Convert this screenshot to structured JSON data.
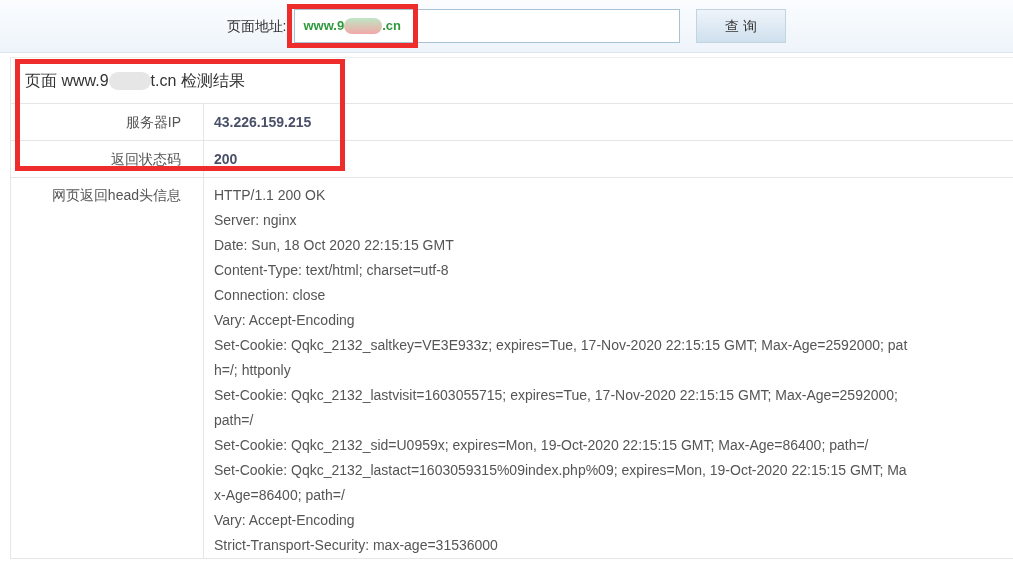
{
  "address_bar": {
    "highlighted": true,
    "label": "页面地址:",
    "value_prefix": "www.9",
    "value_redacted": true,
    "value_suffix": ".cn",
    "button": "查 询"
  },
  "result": {
    "highlighted": true,
    "title_prefix": "页面 www.9",
    "title_redacted": true,
    "title_suffix": "t.cn 检测结果",
    "rows": [
      {
        "kind": "value",
        "label": "服务器IP",
        "value": "43.226.159.215"
      },
      {
        "kind": "value",
        "label": "返回状态码",
        "value": "200"
      },
      {
        "kind": "lines",
        "label": "网页返回head头信息",
        "lines": [
          "HTTP/1.1 200 OK",
          "Server: nginx",
          "Date: Sun, 18 Oct 2020 22:15:15 GMT",
          "Content-Type: text/html; charset=utf-8",
          "Connection: close",
          "Vary: Accept-Encoding",
          "Set-Cookie: Qqkc_2132_saltkey=VE3E933z; expires=Tue, 17-Nov-2020 22:15:15 GMT; Max-Age=2592000; path=/; httponly",
          "Set-Cookie: Qqkc_2132_lastvisit=1603055715; expires=Tue, 17-Nov-2020 22:15:15 GMT; Max-Age=2592000; path=/",
          "Set-Cookie: Qqkc_2132_sid=U0959x; expires=Mon, 19-Oct-2020 22:15:15 GMT; Max-Age=86400; path=/",
          "Set-Cookie: Qqkc_2132_lastact=1603059315%09index.php%09; expires=Mon, 19-Oct-2020 22:15:15 GMT; Max-Age=86400; path=/",
          "Vary: Accept-Encoding",
          "Strict-Transport-Security: max-age=31536000"
        ]
      }
    ]
  }
}
